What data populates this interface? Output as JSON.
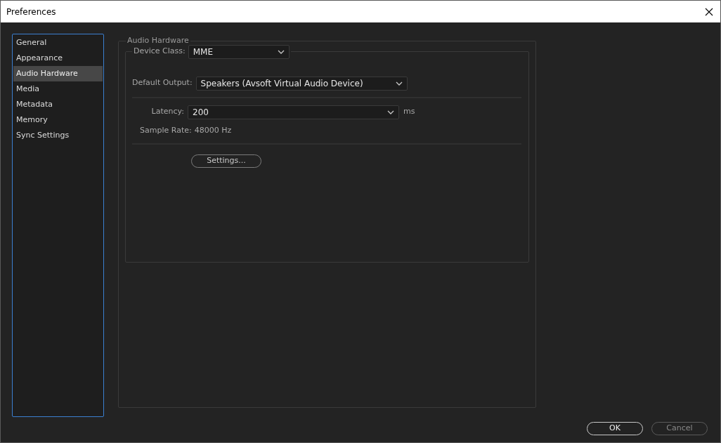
{
  "window": {
    "title": "Preferences"
  },
  "sidebar": {
    "items": [
      {
        "label": "General",
        "selected": false
      },
      {
        "label": "Appearance",
        "selected": false
      },
      {
        "label": "Audio Hardware",
        "selected": true
      },
      {
        "label": "Media",
        "selected": false
      },
      {
        "label": "Metadata",
        "selected": false
      },
      {
        "label": "Memory",
        "selected": false
      },
      {
        "label": "Sync Settings",
        "selected": false
      }
    ]
  },
  "panel": {
    "title": "Audio Hardware",
    "device_class": {
      "label": "Device Class:",
      "value": "MME"
    },
    "default_output": {
      "label": "Default Output:",
      "value": "Speakers (Avsoft Virtual Audio Device)"
    },
    "latency": {
      "label": "Latency:",
      "value": "200",
      "unit": "ms"
    },
    "sample_rate": {
      "label": "Sample Rate:",
      "value": "48000 Hz"
    },
    "settings_button": "Settings..."
  },
  "buttons": [
    {
      "label": "OK",
      "disabled": false
    },
    {
      "label": "Cancel",
      "disabled": true
    }
  ]
}
